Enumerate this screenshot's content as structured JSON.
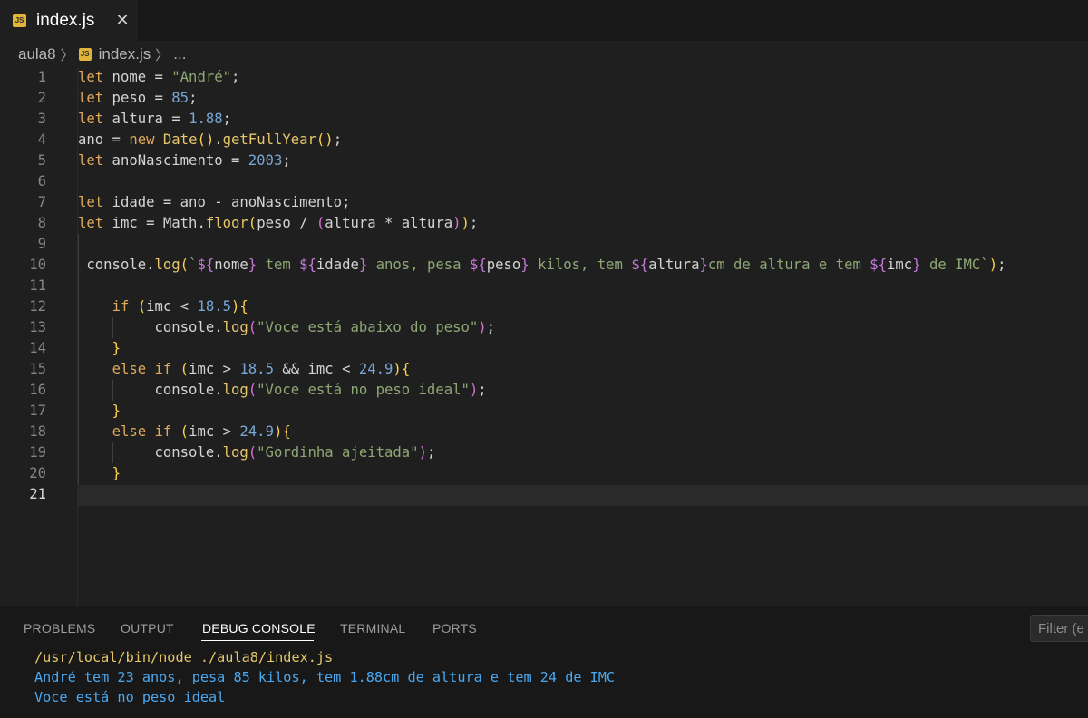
{
  "tab": {
    "badge": "JS",
    "title": "index.js",
    "close": "✕"
  },
  "breadcrumb": {
    "folder": "aula8",
    "sep1": "〉",
    "badge": "JS",
    "file": "index.js",
    "sep2": "〉",
    "more": "..."
  },
  "code": {
    "lines": [
      [
        [
          "kw",
          "let"
        ],
        [
          "var",
          " nome = "
        ],
        [
          "str",
          "\"André\""
        ],
        [
          "var",
          ";"
        ]
      ],
      [
        [
          "kw",
          "let"
        ],
        [
          "var",
          " peso = "
        ],
        [
          "num",
          "85"
        ],
        [
          "var",
          ";"
        ]
      ],
      [
        [
          "kw",
          "let"
        ],
        [
          "var",
          " altura = "
        ],
        [
          "num",
          "1.88"
        ],
        [
          "var",
          ";"
        ]
      ],
      [
        [
          "var",
          "ano = "
        ],
        [
          "kw",
          "new"
        ],
        [
          "var",
          " "
        ],
        [
          "fn",
          "Date"
        ],
        [
          "bk1",
          "()"
        ],
        [
          "var",
          "."
        ],
        [
          "fn",
          "getFullYear"
        ],
        [
          "bk1",
          "()"
        ],
        [
          "var",
          ";"
        ]
      ],
      [
        [
          "kw",
          "let"
        ],
        [
          "var",
          " anoNascimento = "
        ],
        [
          "num",
          "2003"
        ],
        [
          "var",
          ";"
        ]
      ],
      [],
      [
        [
          "kw",
          "let"
        ],
        [
          "var",
          " idade = ano - anoNascimento;"
        ]
      ],
      [
        [
          "kw",
          "let"
        ],
        [
          "var",
          " imc = Math."
        ],
        [
          "fn",
          "floor"
        ],
        [
          "bk1",
          "("
        ],
        [
          "var",
          "peso / "
        ],
        [
          "bk2",
          "("
        ],
        [
          "var",
          "altura * altura"
        ],
        [
          "bk2",
          ")"
        ],
        [
          "bk1",
          ")"
        ],
        [
          "var",
          ";"
        ]
      ],
      [],
      [
        [
          "var",
          " console."
        ],
        [
          "fn",
          "log"
        ],
        [
          "bk1",
          "("
        ],
        [
          "str",
          "`"
        ],
        [
          "tpl",
          "${"
        ],
        [
          "var",
          "nome"
        ],
        [
          "tpl",
          "}"
        ],
        [
          "str",
          " tem "
        ],
        [
          "tpl",
          "${"
        ],
        [
          "var",
          "idade"
        ],
        [
          "tpl",
          "}"
        ],
        [
          "str",
          " anos, pesa "
        ],
        [
          "tpl",
          "${"
        ],
        [
          "var",
          "peso"
        ],
        [
          "tpl",
          "}"
        ],
        [
          "str",
          " kilos, tem "
        ],
        [
          "tpl",
          "${"
        ],
        [
          "var",
          "altura"
        ],
        [
          "tpl",
          "}"
        ],
        [
          "str",
          "cm de altura e tem "
        ],
        [
          "tpl",
          "${"
        ],
        [
          "var",
          "imc"
        ],
        [
          "tpl",
          "}"
        ],
        [
          "str",
          " de IMC`"
        ],
        [
          "bk1",
          ")"
        ],
        [
          "var",
          ";"
        ]
      ],
      [],
      [
        [
          "var",
          "    "
        ],
        [
          "kw",
          "if"
        ],
        [
          "var",
          " "
        ],
        [
          "bk1",
          "("
        ],
        [
          "var",
          "imc < "
        ],
        [
          "num",
          "18.5"
        ],
        [
          "bk1",
          ")"
        ],
        [
          "bk1",
          "{"
        ]
      ],
      [
        [
          "var",
          "         console."
        ],
        [
          "fn",
          "log"
        ],
        [
          "bk2",
          "("
        ],
        [
          "str",
          "\"Voce está abaixo do peso\""
        ],
        [
          "bk2",
          ")"
        ],
        [
          "var",
          ";"
        ]
      ],
      [
        [
          "var",
          "    "
        ],
        [
          "bk1",
          "}"
        ]
      ],
      [
        [
          "var",
          "    "
        ],
        [
          "kw",
          "else if"
        ],
        [
          "var",
          " "
        ],
        [
          "bk1",
          "("
        ],
        [
          "var",
          "imc > "
        ],
        [
          "num",
          "18.5"
        ],
        [
          "var",
          " && imc < "
        ],
        [
          "num",
          "24.9"
        ],
        [
          "bk1",
          ")"
        ],
        [
          "bk1",
          "{"
        ]
      ],
      [
        [
          "var",
          "         console."
        ],
        [
          "fn",
          "log"
        ],
        [
          "bk2",
          "("
        ],
        [
          "str",
          "\"Voce está no peso ideal\""
        ],
        [
          "bk2",
          ")"
        ],
        [
          "var",
          ";"
        ]
      ],
      [
        [
          "var",
          "    "
        ],
        [
          "bk1",
          "}"
        ]
      ],
      [
        [
          "var",
          "    "
        ],
        [
          "kw",
          "else if"
        ],
        [
          "var",
          " "
        ],
        [
          "bk1",
          "("
        ],
        [
          "var",
          "imc > "
        ],
        [
          "num",
          "24.9"
        ],
        [
          "bk1",
          ")"
        ],
        [
          "bk1",
          "{"
        ]
      ],
      [
        [
          "var",
          "         console."
        ],
        [
          "fn",
          "log"
        ],
        [
          "bk2",
          "("
        ],
        [
          "str",
          "\"Gordinha ajeitada\""
        ],
        [
          "bk2",
          ")"
        ],
        [
          "var",
          ";"
        ]
      ],
      [
        [
          "var",
          "    "
        ],
        [
          "bk1",
          "}"
        ]
      ],
      []
    ],
    "active_line": 21
  },
  "panel": {
    "tabs": [
      "PROBLEMS",
      "OUTPUT",
      "DEBUG CONSOLE",
      "TERMINAL",
      "PORTS"
    ],
    "active_tab": "DEBUG CONSOLE",
    "filter_placeholder": "Filter (e",
    "output": [
      "/usr/local/bin/node ./aula8/index.js",
      "André tem 23 anos, pesa 85 kilos, tem 1.88cm de altura e tem 24 de IMC",
      "Voce está no peso ideal"
    ]
  }
}
